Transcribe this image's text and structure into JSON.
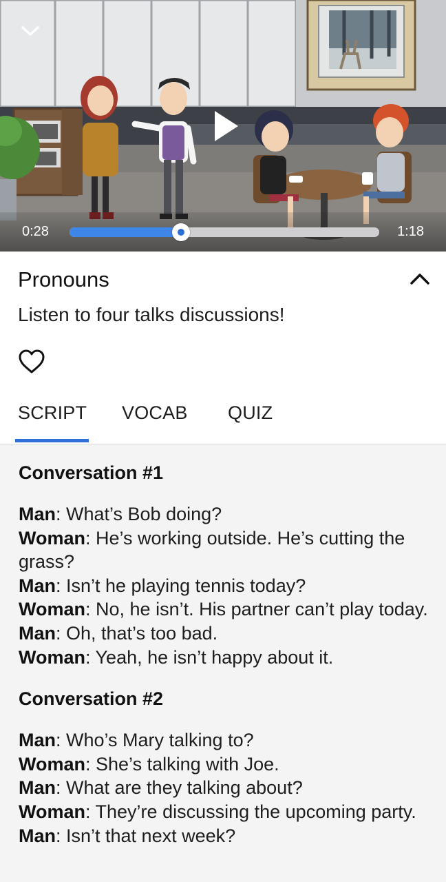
{
  "video": {
    "time_current": "0:28",
    "time_total": "1:18",
    "progress": 0.36,
    "icons": {
      "collapse": "chevron-down-icon",
      "play": "play-icon"
    }
  },
  "lesson": {
    "title": "Pronouns",
    "description": "Listen to four talks discussions!",
    "icons": {
      "collapse": "chevron-up-icon",
      "favorite": "heart-icon"
    }
  },
  "tabs": [
    {
      "label": "SCRIPT",
      "active": true
    },
    {
      "label": "VOCAB",
      "active": false
    },
    {
      "label": "QUIZ",
      "active": false
    }
  ],
  "colors": {
    "accent": "#2f6fd8",
    "seek_fill": "#3f86e9",
    "content_bg": "#f4f4f4"
  },
  "script": {
    "conversations": [
      {
        "heading": "Conversation #1",
        "lines": [
          {
            "speaker": "Man",
            "text": ": What’s Bob doing?"
          },
          {
            "speaker": "Woman",
            "text": ": He’s working outside. He’s cutting the grass?"
          },
          {
            "speaker": "Man",
            "text": ": Isn’t he playing tennis today?"
          },
          {
            "speaker": "Woman",
            "text": ": No, he isn’t. His partner can’t play today."
          },
          {
            "speaker": "Man",
            "text": ": Oh, that’s too bad."
          },
          {
            "speaker": "Woman",
            "text": ": Yeah, he isn’t happy about it."
          }
        ]
      },
      {
        "heading": "Conversation #2",
        "lines": [
          {
            "speaker": "Man",
            "text": ": Who’s Mary talking to?"
          },
          {
            "speaker": "Woman",
            "text": ": She’s talking with Joe."
          },
          {
            "speaker": "Man",
            "text": ": What are they talking about?"
          },
          {
            "speaker": "Woman",
            "text": ": They’re discussing the upcoming party."
          },
          {
            "speaker": "Man",
            "text": ": Isn’t that next week?"
          }
        ]
      }
    ]
  }
}
